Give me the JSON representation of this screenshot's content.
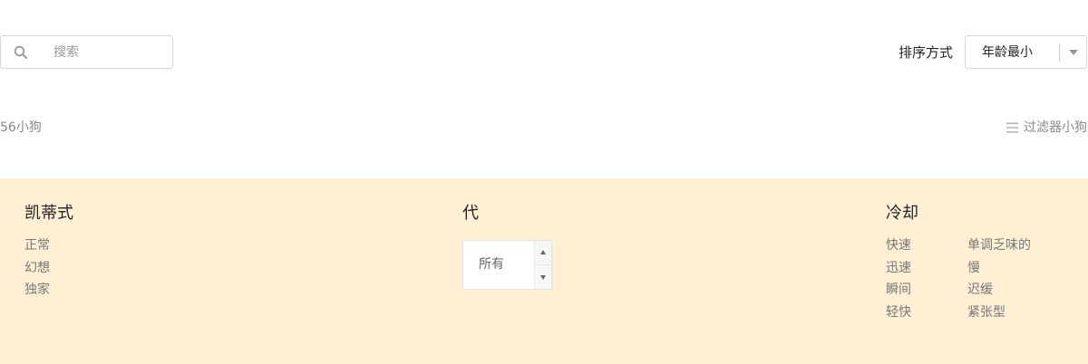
{
  "search": {
    "placeholder": "搜索",
    "value": ""
  },
  "sort": {
    "label": "排序方式",
    "selected": "年龄最小"
  },
  "results": {
    "count_text": "56小狗",
    "filter_label": "过滤器小狗"
  },
  "filters": {
    "style": {
      "title": "凯蒂式",
      "options": [
        "正常",
        "幻想",
        "独家"
      ]
    },
    "generation": {
      "title": "代",
      "value": "所有"
    },
    "cooldown": {
      "title": "冷却",
      "options_col1": [
        "快速",
        "迅速",
        "瞬间",
        "轻快"
      ],
      "options_col2": [
        "单调乏味的",
        "慢",
        "迟缓",
        "紧张型"
      ]
    }
  },
  "colors": {
    "panel_bg": "#fff0d5",
    "muted_text": "#888888"
  }
}
